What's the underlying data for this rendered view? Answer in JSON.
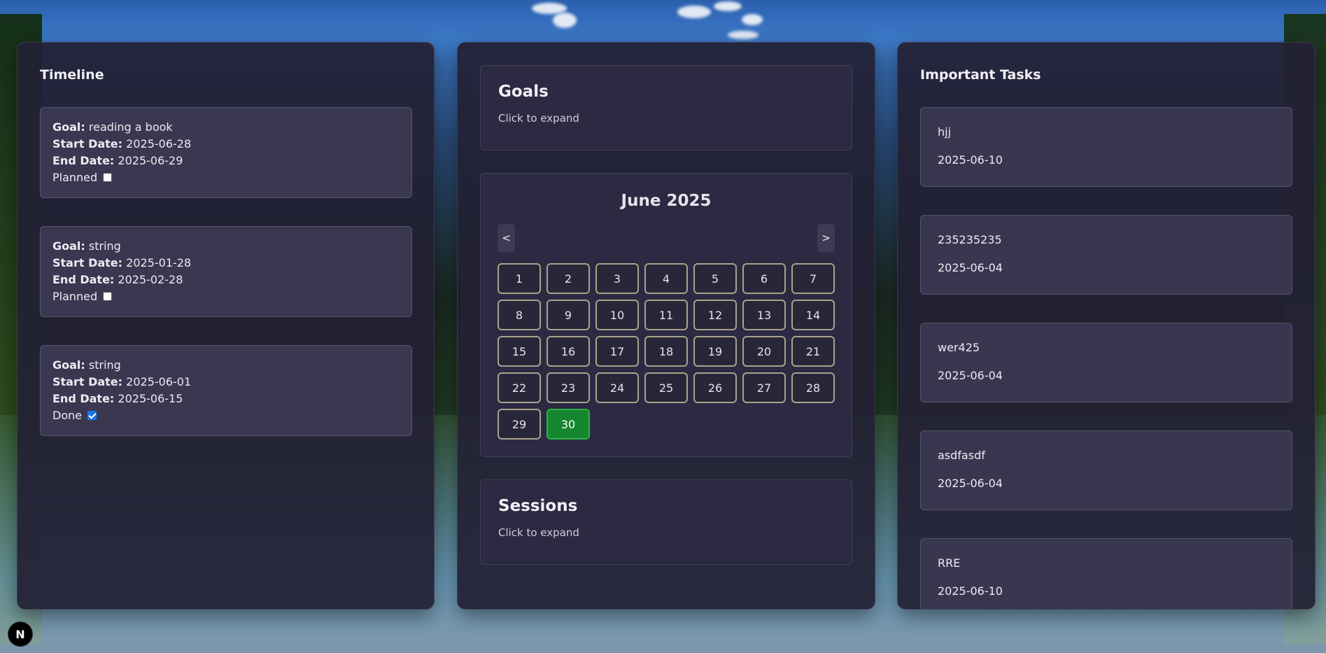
{
  "timeline": {
    "title": "Timeline",
    "goal_label": "Goal:",
    "start_label": "Start Date:",
    "end_label": "End Date:",
    "items": [
      {
        "goal": "reading a book",
        "start": "2025-06-28",
        "end": "2025-06-29",
        "status": "Planned",
        "checked": false
      },
      {
        "goal": "string",
        "start": "2025-01-28",
        "end": "2025-02-28",
        "status": "Planned",
        "checked": false
      },
      {
        "goal": "string",
        "start": "2025-06-01",
        "end": "2025-06-15",
        "status": "Done",
        "checked": true
      }
    ]
  },
  "goals": {
    "title": "Goals",
    "subtitle": "Click to expand"
  },
  "calendar": {
    "month_label": "June 2025",
    "prev_label": "<",
    "next_label": ">",
    "days": [
      "1",
      "2",
      "3",
      "4",
      "5",
      "6",
      "7",
      "8",
      "9",
      "10",
      "11",
      "12",
      "13",
      "14",
      "15",
      "16",
      "17",
      "18",
      "19",
      "20",
      "21",
      "22",
      "23",
      "24",
      "25",
      "26",
      "27",
      "28",
      "29",
      "30"
    ],
    "today": "30",
    "today_color": "#16852f"
  },
  "sessions": {
    "title": "Sessions",
    "subtitle": "Click to expand"
  },
  "tasks": {
    "title": "Important Tasks",
    "items": [
      {
        "name": "hjj",
        "date": "2025-06-10"
      },
      {
        "name": "235235235",
        "date": "2025-06-04"
      },
      {
        "name": "wer425",
        "date": "2025-06-04"
      },
      {
        "name": "asdfasdf",
        "date": "2025-06-04"
      },
      {
        "name": "RRE",
        "date": "2025-06-10"
      }
    ]
  },
  "badge": {
    "label": "N"
  }
}
